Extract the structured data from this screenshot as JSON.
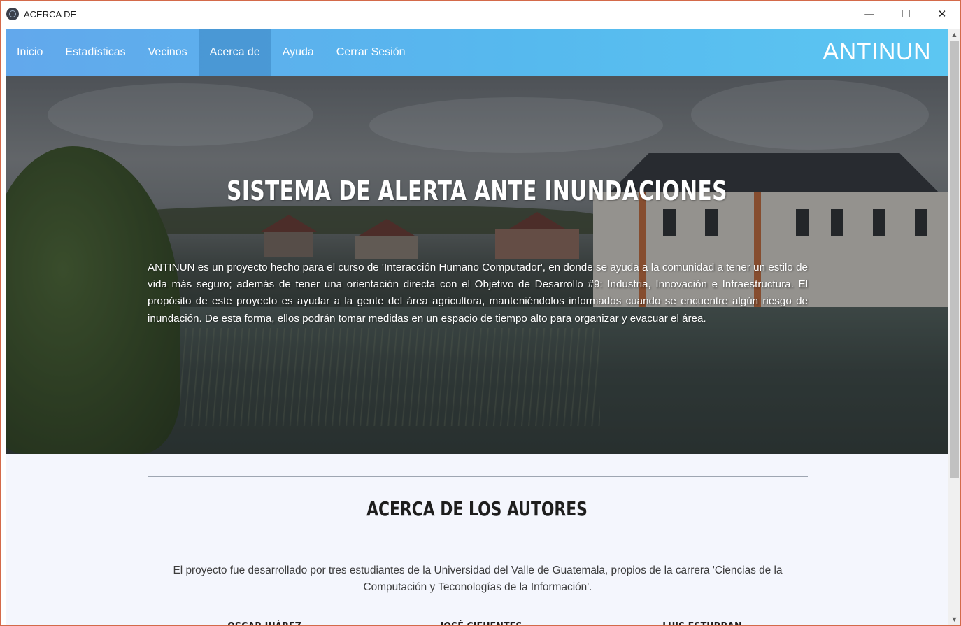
{
  "window": {
    "title": "ACERCA DE",
    "minimize_label": "—",
    "maximize_label": "☐",
    "close_label": "✕"
  },
  "nav": {
    "items": [
      {
        "label": "Inicio"
      },
      {
        "label": "Estadísticas"
      },
      {
        "label": "Vecinos"
      },
      {
        "label": "Acerca de"
      },
      {
        "label": "Ayuda"
      },
      {
        "label": "Cerrar Sesión"
      }
    ],
    "active_index": 3,
    "brand": "ANTINUN"
  },
  "hero": {
    "title": "SISTEMA DE ALERTA ANTE INUNDACIONES",
    "description": "ANTINUN es un proyecto hecho para el curso de 'Interacción Humano Computador', en donde se ayuda a la comunidad a tener un estilo de vida más seguro; además de tener una orientación directa con el Objetivo de Desarrollo #9: Industria, Innovación e Infraestructura. El propósito de este proyecto es ayudar a la gente del área agricultora, manteniéndolos informados cuando se encuentre algún riesgo de inundación. De esta forma, ellos podrán tomar medidas en un espacio de tiempo alto para organizar y evacuar el área."
  },
  "about": {
    "title": "ACERCA DE LOS AUTORES",
    "text": "El proyecto fue desarrollado por tres estudiantes de la Universidad del Valle de Guatemala, propios de la carrera 'Ciencias de la Computación y Teconologías de la Información'.",
    "authors": [
      {
        "name": "OSCAR JUÁREZ"
      },
      {
        "name": "JOSÉ CIFUENTES"
      },
      {
        "name": "LUIS ESTURBAN"
      }
    ]
  },
  "colors": {
    "nav_gradient_start": "#62a8ec",
    "nav_gradient_end": "#5cc6f2",
    "section_bg": "#f4f6fd",
    "window_border": "#d46a4a"
  }
}
